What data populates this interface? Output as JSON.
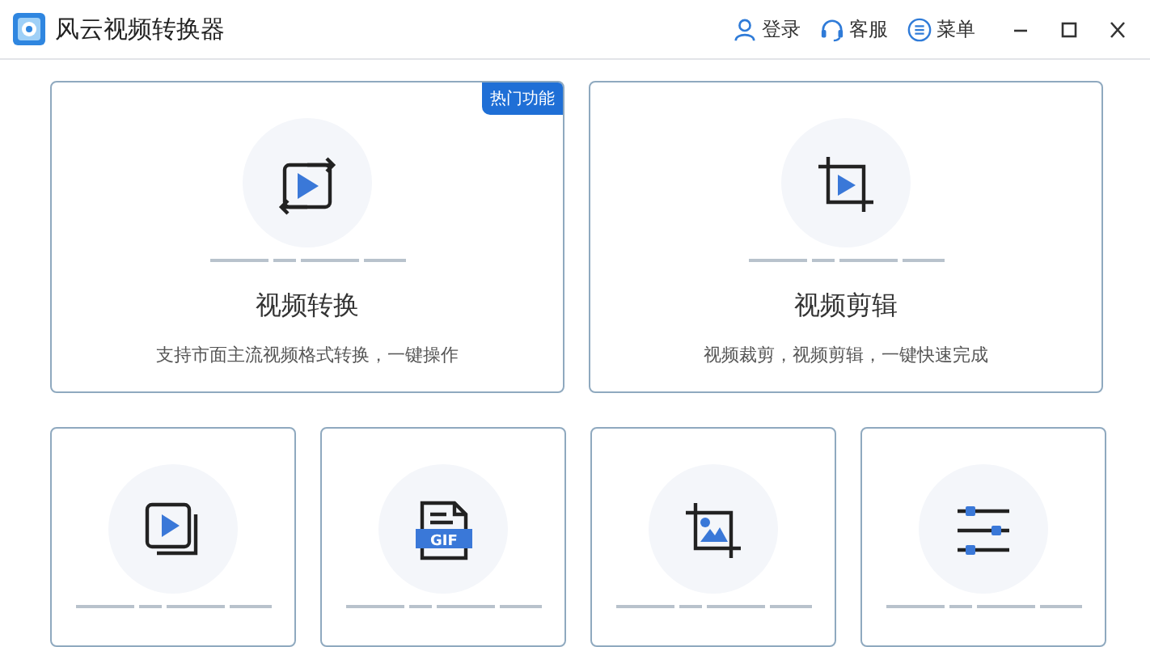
{
  "window": {
    "title": "风云视频转换器"
  },
  "header_actions": [
    {
      "kind": "user",
      "label": "登录"
    },
    {
      "kind": "headset",
      "label": "客服"
    },
    {
      "kind": "menu",
      "label": "菜单"
    }
  ],
  "window_controls": [
    {
      "kind": "minimize"
    },
    {
      "kind": "maximize"
    },
    {
      "kind": "close"
    }
  ],
  "feature_cards": [
    {
      "kind": "convert",
      "title": "视频转换",
      "description": "支持市面主流视频格式转换，一键操作",
      "badge": "热门功能"
    },
    {
      "kind": "crop",
      "title": "视频剪辑",
      "description": "视频裁剪，视频剪辑，一键快速完成"
    }
  ],
  "tool_cards": [
    {
      "kind": "merge"
    },
    {
      "kind": "gif",
      "icon_text": "GIF"
    },
    {
      "kind": "crop-image"
    },
    {
      "kind": "sliders"
    }
  ]
}
